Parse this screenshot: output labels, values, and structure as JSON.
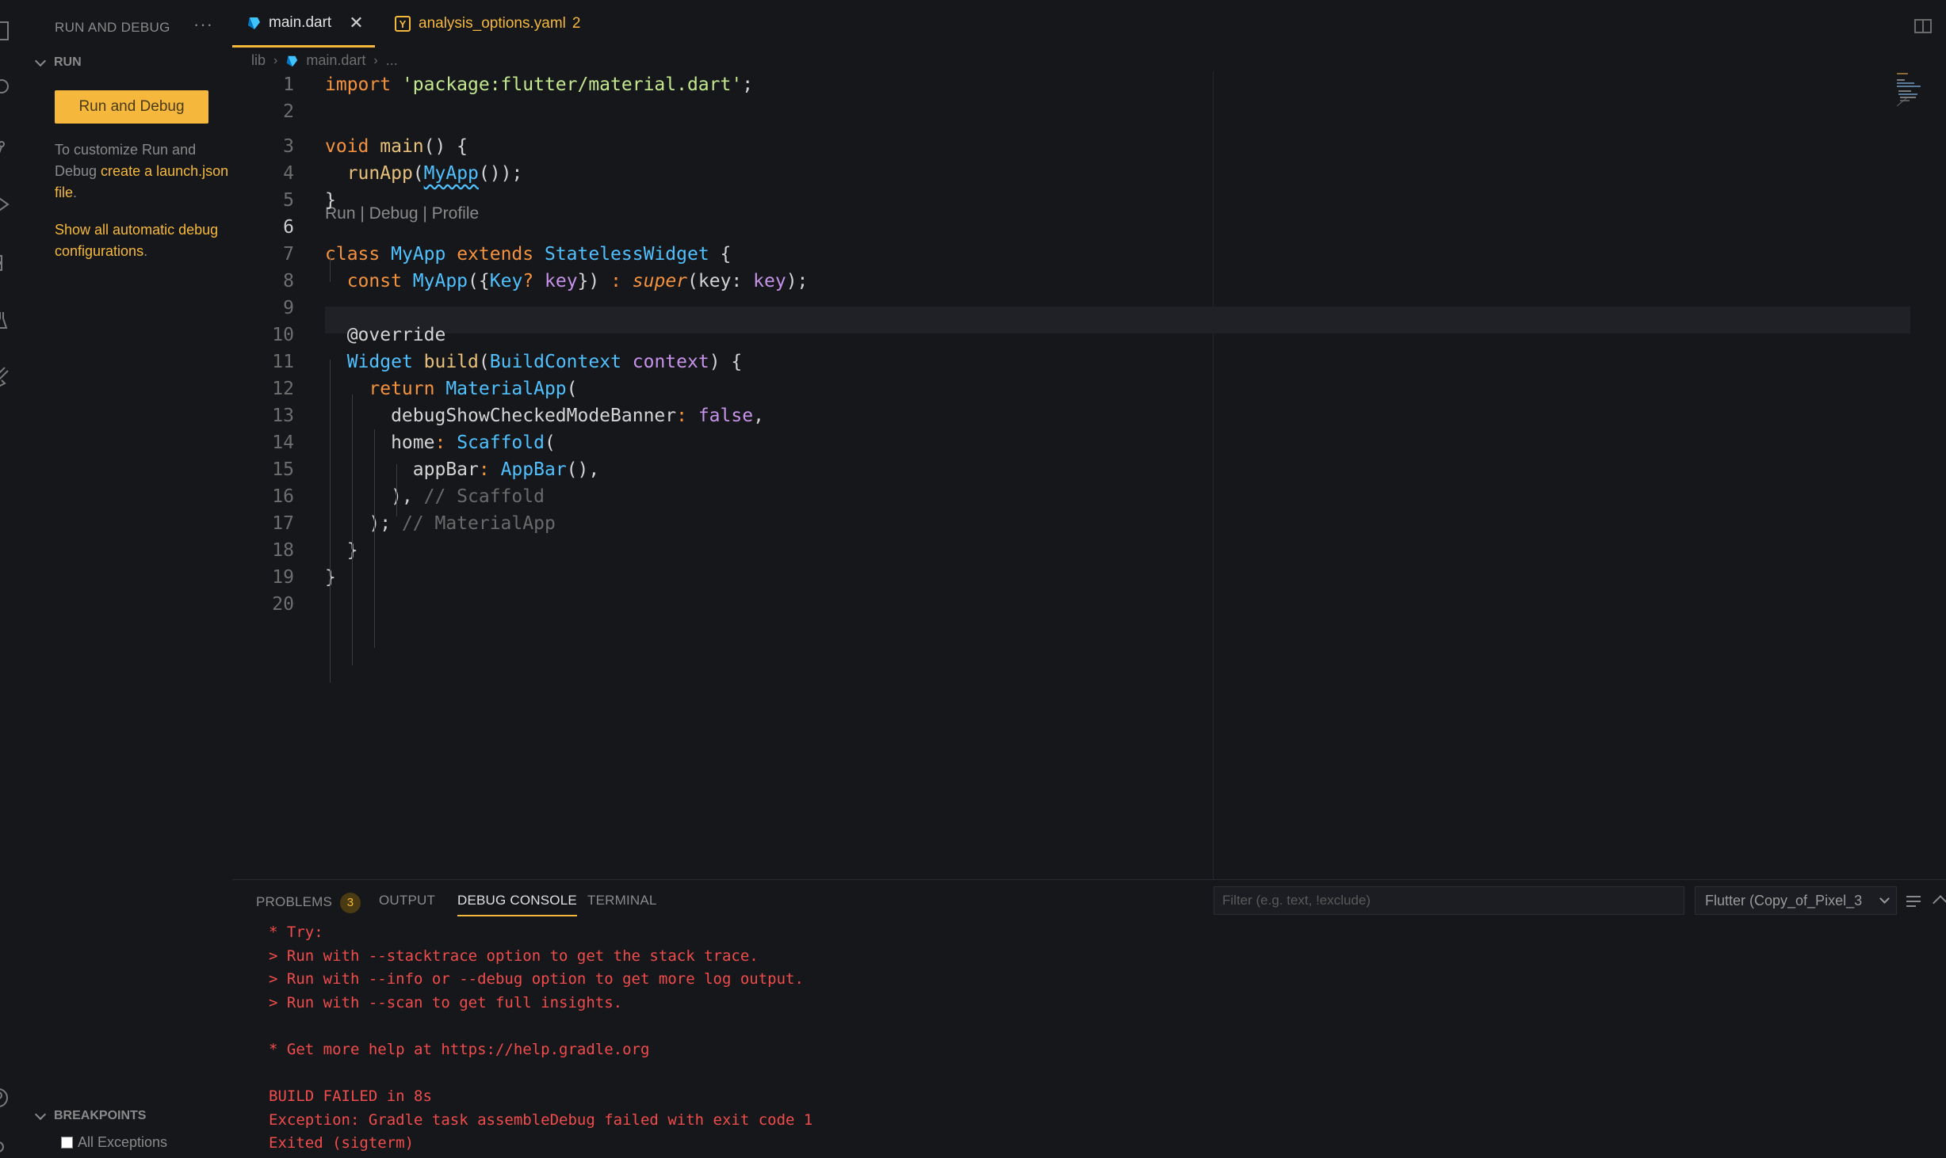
{
  "sidebar": {
    "title": "RUN AND DEBUG",
    "more": "···",
    "run_section": "RUN",
    "run_button": "Run and Debug",
    "help_prefix": "To customize Run and Debug ",
    "help_link": "create a launch.json file",
    "help_suffix": ".",
    "auto_configs_link": "Show all automatic debug configurations",
    "auto_configs_suffix": ".",
    "breakpoints_section": "BREAKPOINTS",
    "all_exceptions": "All Exceptions"
  },
  "tabs": {
    "main": {
      "label": "main.dart",
      "close": "✕"
    },
    "yaml": {
      "label": "analysis_options.yaml",
      "badge": "2",
      "icon_letter": "Y"
    }
  },
  "breadcrumb": {
    "folder": "lib",
    "file": "main.dart",
    "more": "..."
  },
  "codelens": "Run | Debug | Profile",
  "line_numbers": [
    "1",
    "2",
    "3",
    "4",
    "5",
    "6",
    "7",
    "8",
    "9",
    "10",
    "11",
    "12",
    "13",
    "14",
    "15",
    "16",
    "17",
    "18",
    "19",
    "20"
  ],
  "code_lines": [
    [
      [
        "k-or",
        "import "
      ],
      [
        "k-gr",
        "'package:flutter/material.dart'"
      ],
      [
        "",
        ";"
      ]
    ],
    [],
    [
      [
        "k-or",
        "void "
      ],
      [
        "k-yl",
        "main"
      ],
      [
        "",
        "() {"
      ]
    ],
    [
      [
        "",
        "  "
      ],
      [
        "k-yl",
        "runApp"
      ],
      [
        "",
        "("
      ],
      [
        "k-bl squig",
        "MyApp"
      ],
      [
        "",
        "());"
      ]
    ],
    [
      [
        "",
        "}"
      ]
    ],
    [],
    [
      [
        "k-or",
        "class "
      ],
      [
        "k-bl",
        "MyApp "
      ],
      [
        "k-or",
        "extends "
      ],
      [
        "k-bl",
        "StatelessWidget"
      ],
      [
        "",
        " {"
      ]
    ],
    [
      [
        "",
        "  "
      ],
      [
        "k-or",
        "const "
      ],
      [
        "k-bl",
        "MyApp"
      ],
      [
        "",
        "({"
      ],
      [
        "k-bl",
        "Key"
      ],
      [
        "k-or",
        "? "
      ],
      [
        "k-pu",
        "key"
      ],
      [
        "",
        "}) "
      ],
      [
        "k-or",
        ": "
      ],
      [
        "k-it",
        "super"
      ],
      [
        "",
        "(key: "
      ],
      [
        "k-pu",
        "key"
      ],
      [
        "",
        ");"
      ]
    ],
    [],
    [
      [
        "",
        "  @override"
      ]
    ],
    [
      [
        "",
        "  "
      ],
      [
        "k-bl",
        "Widget "
      ],
      [
        "k-yl",
        "build"
      ],
      [
        "",
        "("
      ],
      [
        "k-bl",
        "BuildContext "
      ],
      [
        "k-pu",
        "context"
      ],
      [
        "",
        ") {"
      ]
    ],
    [
      [
        "",
        "    "
      ],
      [
        "k-or",
        "return "
      ],
      [
        "k-bl",
        "MaterialApp"
      ],
      [
        "",
        "("
      ]
    ],
    [
      [
        "",
        "      debugShowCheckedModeBanner"
      ],
      [
        "k-or",
        ": "
      ],
      [
        "k-pu",
        "false"
      ],
      [
        "",
        ","
      ]
    ],
    [
      [
        "",
        "      home"
      ],
      [
        "k-or",
        ": "
      ],
      [
        "k-bl",
        "Scaffold"
      ],
      [
        "",
        "("
      ]
    ],
    [
      [
        "",
        "        appBar"
      ],
      [
        "k-or",
        ": "
      ],
      [
        "k-bl",
        "AppBar"
      ],
      [
        "",
        "(),"
      ]
    ],
    [
      [
        "",
        "      ), "
      ],
      [
        "k-cm",
        "// Scaffold"
      ]
    ],
    [
      [
        "",
        "    ); "
      ],
      [
        "k-cm",
        "// MaterialApp"
      ]
    ],
    [
      [
        "",
        "  }"
      ]
    ],
    [
      [
        "",
        "}"
      ]
    ],
    []
  ],
  "panel": {
    "tabs": [
      "PROBLEMS",
      "OUTPUT",
      "DEBUG CONSOLE",
      "TERMINAL"
    ],
    "problems_count": "3",
    "filter_placeholder": "Filter (e.g. text, !exclude)",
    "target": "Flutter (Copy_of_Pixel_3",
    "console_lines": [
      "* Try:",
      "> Run with --stacktrace option to get the stack trace.",
      "> Run with --info or --debug option to get more log output.",
      "> Run with --scan to get full insights.",
      "",
      "* Get more help at https://help.gradle.org",
      "",
      "BUILD FAILED in 8s",
      "Exception: Gradle task assembleDebug failed with exit code 1",
      "Exited (sigterm)"
    ]
  },
  "colors": {
    "accent": "#f5b83d",
    "error": "#f14c4c",
    "background": "#16171b"
  },
  "icons": [
    "explorer-icon",
    "search-icon",
    "source-control-icon",
    "run-debug-icon",
    "extensions-icon",
    "testing-icon",
    "flutter-icon",
    "account-icon",
    "settings-icon",
    "dart-file-icon",
    "yaml-file-icon",
    "split-editor-icon",
    "minimap",
    "filter-menu-icon",
    "chevron-up-icon"
  ]
}
